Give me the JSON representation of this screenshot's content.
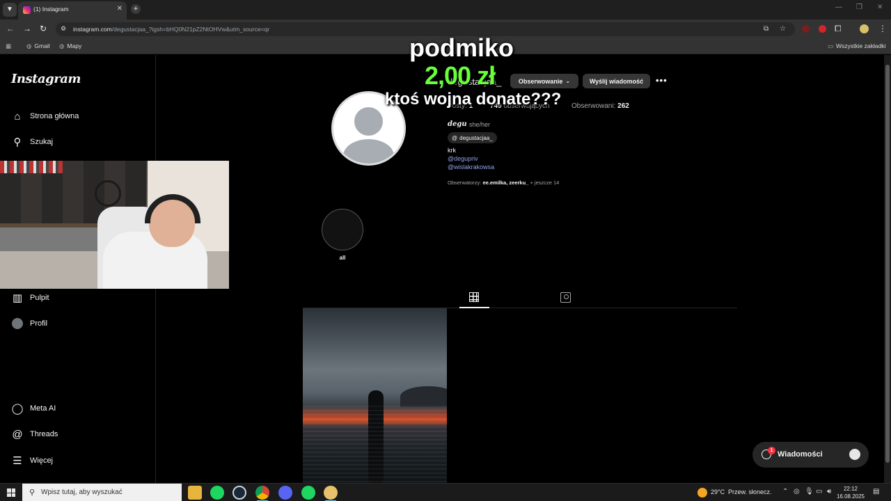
{
  "browser": {
    "tab_title": "(1) Instagram",
    "url_host": "instagram.com",
    "url_path": "/degustacjaa_?igsh=bHQ0N21pZ2NtOHVw&utm_source=qr",
    "bookmarks": [
      "Gmail",
      "Mapy"
    ],
    "all_bookmarks": "Wszystkie zakładki"
  },
  "sidebar": {
    "logo": "Instagram",
    "items": [
      {
        "label": "Strona główna",
        "icon": "home-icon"
      },
      {
        "label": "Szukaj",
        "icon": "search-icon"
      },
      {
        "label": "Pulpit",
        "icon": "dashboard-icon"
      },
      {
        "label": "Profil",
        "icon": "avatar"
      },
      {
        "label": "Meta AI",
        "icon": "meta-ai-icon"
      },
      {
        "label": "Threads",
        "icon": "threads-icon"
      },
      {
        "label": "Więcej",
        "icon": "menu-icon"
      }
    ]
  },
  "profile": {
    "username": "degustacjaa_",
    "follow_button": "Obserwowanie",
    "message_button": "Wyślij wiadomość",
    "posts_label": "Posty:",
    "posts_count": "1",
    "followers_count": "749",
    "followers_label": "obserwujących",
    "following_label": "Obserwowani:",
    "following_count": "262",
    "full_name": "degu",
    "pronouns": "she/her",
    "threads_handle": "degustacjaa_",
    "bio": "krk",
    "bio_links": [
      "@degupriv",
      "@wislakrakowsa"
    ],
    "followed_by_prefix": "Obserwatorzy:",
    "followed_by_names": "ee.emilka, zeerku_",
    "followed_by_suffix": "+ jeszcze 14",
    "highlight_label": "all"
  },
  "donation": {
    "donor": "podmiko",
    "amount": "2,00 zł",
    "message": "ktoś wojna donate???",
    "amount_color": "#68ff3a"
  },
  "messages_widget": {
    "label": "Wiadomości",
    "badge": "1"
  },
  "taskbar": {
    "search_placeholder": "Wpisz tutaj, aby wyszukać",
    "temperature": "29°C",
    "weather": "Przew. słonecz.",
    "time": "22:12",
    "date": "16.08.2025"
  }
}
